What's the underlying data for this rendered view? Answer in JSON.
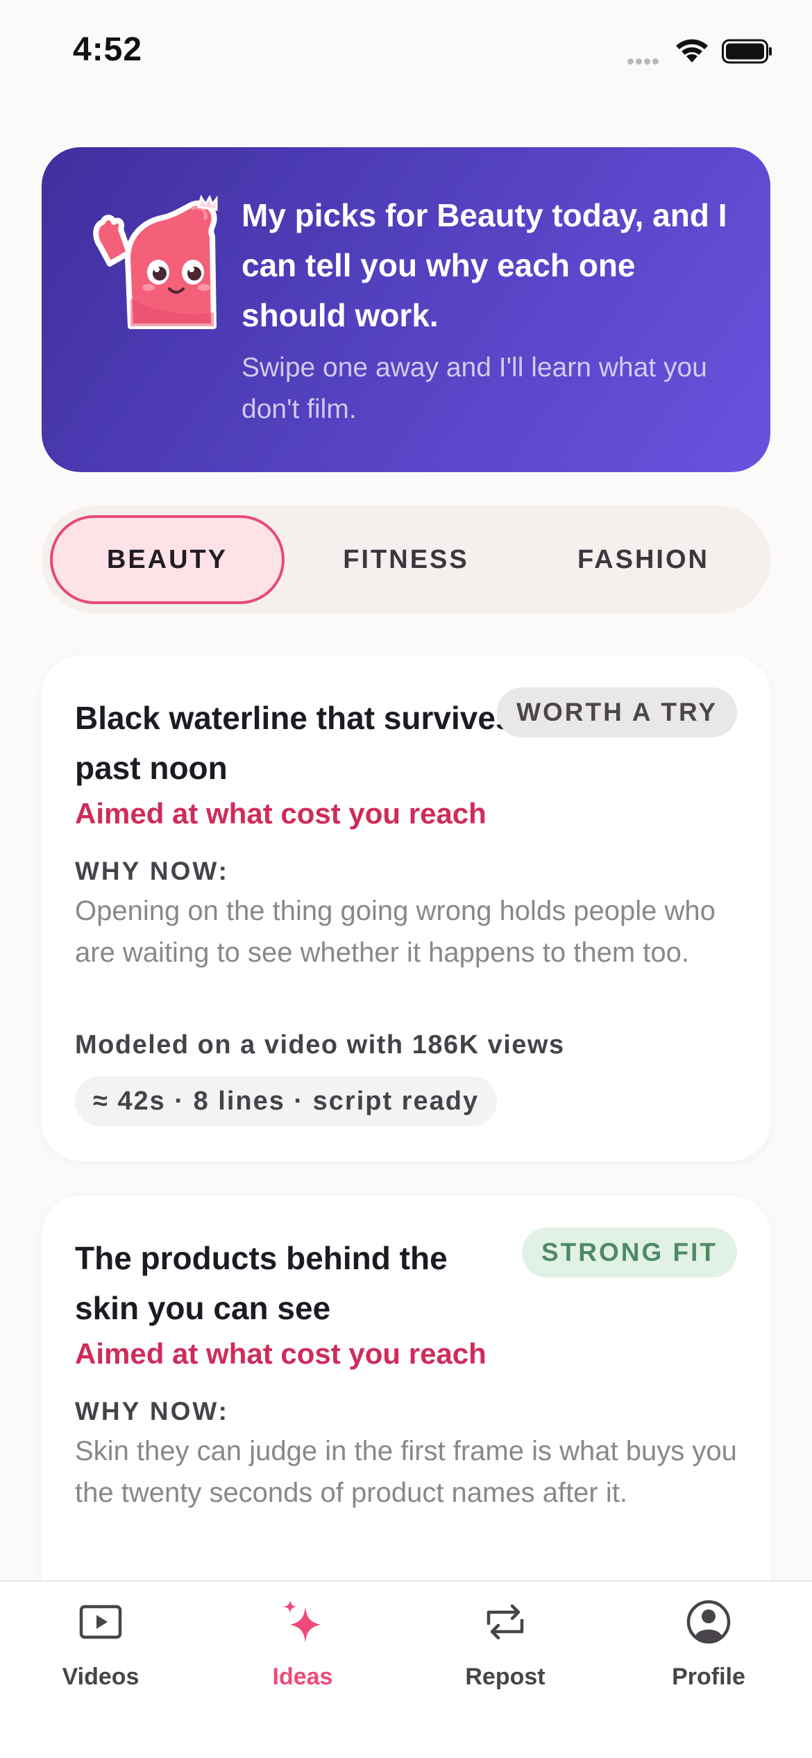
{
  "status": {
    "time": "4:52"
  },
  "hero": {
    "title": "My picks for Beauty today, and I can tell you why each one should work.",
    "subtitle": "Swipe one away and I'll learn what you don't film.",
    "mascot_icon": "waving-mascot-icon"
  },
  "tabs": [
    {
      "label": "BEAUTY",
      "active": true
    },
    {
      "label": "FITNESS",
      "active": false
    },
    {
      "label": "FASHION",
      "active": false
    }
  ],
  "cards": [
    {
      "title": "Black waterline that survives past noon",
      "badge": "WORTH A TRY",
      "aim": "Aimed at what cost you reach",
      "why_label": "WHY NOW:",
      "why_text": "Opening on the thing going wrong holds people who are waiting to see whether it happens to them too.",
      "modeled": "Modeled on a video with 186K views",
      "meta": "≈ 42s · 8 lines · script ready"
    },
    {
      "title": "The products behind the skin you can see",
      "badge": "STRONG FIT",
      "aim": "Aimed at what cost you reach",
      "why_label": "WHY NOW:",
      "why_text": "Skin they can judge in the first frame is what buys you the twenty seconds of product names after it."
    }
  ],
  "tabbar": [
    {
      "label": "Videos",
      "icon": "play-video-icon",
      "active": false
    },
    {
      "label": "Ideas",
      "icon": "sparkle-icon",
      "active": true
    },
    {
      "label": "Repost",
      "icon": "repost-icon",
      "active": false
    },
    {
      "label": "Profile",
      "icon": "profile-icon",
      "active": false
    }
  ],
  "colors": {
    "accent": "#ee4a79",
    "hero_start": "#3f2f9e",
    "hero_end": "#6a52de",
    "aim_text": "#cf2b5b",
    "strong_badge": "#4e8a64"
  }
}
